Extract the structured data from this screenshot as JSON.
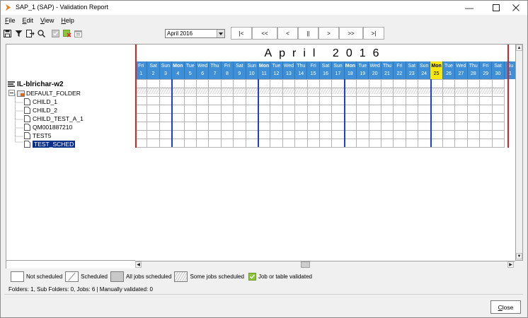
{
  "window": {
    "title": "SAP_1 (SAP) - Validation Report",
    "minimize_icon": "minimize-icon",
    "maximize_icon": "maximize-icon",
    "close_icon": "close-icon"
  },
  "menu": [
    {
      "label": "File",
      "ul": "F",
      "rest": "ile"
    },
    {
      "label": "Edit",
      "ul": "E",
      "rest": "dit"
    },
    {
      "label": "View",
      "ul": "V",
      "rest": "iew"
    },
    {
      "label": "Help",
      "ul": "H",
      "rest": "elp"
    }
  ],
  "toolbar": {
    "icons": [
      "save-icon",
      "filter-icon",
      "export-icon",
      "search-icon",
      "validate-icon",
      "remove-validation-icon",
      "calendar-icon"
    ]
  },
  "nav": {
    "month_value": "April 2016",
    "buttons": [
      "|<",
      "<<",
      "<",
      "||",
      ">",
      ">>",
      ">|"
    ]
  },
  "calendar": {
    "title": "April 2016",
    "days": [
      {
        "name": "Fri",
        "num": "1"
      },
      {
        "name": "Sat",
        "num": "2"
      },
      {
        "name": "Sun",
        "num": "3"
      },
      {
        "name": "Mon",
        "num": "4"
      },
      {
        "name": "Tue",
        "num": "5"
      },
      {
        "name": "Wed",
        "num": "6"
      },
      {
        "name": "Thu",
        "num": "7"
      },
      {
        "name": "Fri",
        "num": "8"
      },
      {
        "name": "Sat",
        "num": "9"
      },
      {
        "name": "Sun",
        "num": "10"
      },
      {
        "name": "Mon",
        "num": "11"
      },
      {
        "name": "Tue",
        "num": "12"
      },
      {
        "name": "Wed",
        "num": "13"
      },
      {
        "name": "Thu",
        "num": "14"
      },
      {
        "name": "Fri",
        "num": "15"
      },
      {
        "name": "Sat",
        "num": "16"
      },
      {
        "name": "Sun",
        "num": "17"
      },
      {
        "name": "Mon",
        "num": "18"
      },
      {
        "name": "Tue",
        "num": "19"
      },
      {
        "name": "Wed",
        "num": "20"
      },
      {
        "name": "Thu",
        "num": "21"
      },
      {
        "name": "Fri",
        "num": "22"
      },
      {
        "name": "Sat",
        "num": "23"
      },
      {
        "name": "Sun",
        "num": "24"
      },
      {
        "name": "Mon",
        "num": "25"
      },
      {
        "name": "Tue",
        "num": "26"
      },
      {
        "name": "Wed",
        "num": "27"
      },
      {
        "name": "Thu",
        "num": "28"
      },
      {
        "name": "Fri",
        "num": "29"
      },
      {
        "name": "Sat",
        "num": "30"
      },
      {
        "name": "Su",
        "num": "1"
      }
    ],
    "today_num": "25",
    "accent_color": "#3e8fd6",
    "today_color": "#f8e610"
  },
  "tree": {
    "root": "IL-blrichar-w2",
    "folder": "DEFAULT_FOLDER",
    "jobs": [
      "CHILD_1",
      "CHILD_2",
      "CHILD_TEST_A_1",
      "QM001887210",
      "TEST5",
      "TEST_SCHED"
    ],
    "selected_job": "TEST_SCHED"
  },
  "legend": {
    "not_scheduled": "Not scheduled",
    "scheduled": "Scheduled",
    "all_jobs": "All jobs scheduled",
    "some_jobs": "Some jobs scheduled",
    "validated": "Job or table validated"
  },
  "status": "Folders: 1, Sub Folders: 0, Jobs: 6 | Manually validated: 0",
  "close_button": {
    "label": "Close",
    "ul": "C",
    "rest": "lose"
  }
}
